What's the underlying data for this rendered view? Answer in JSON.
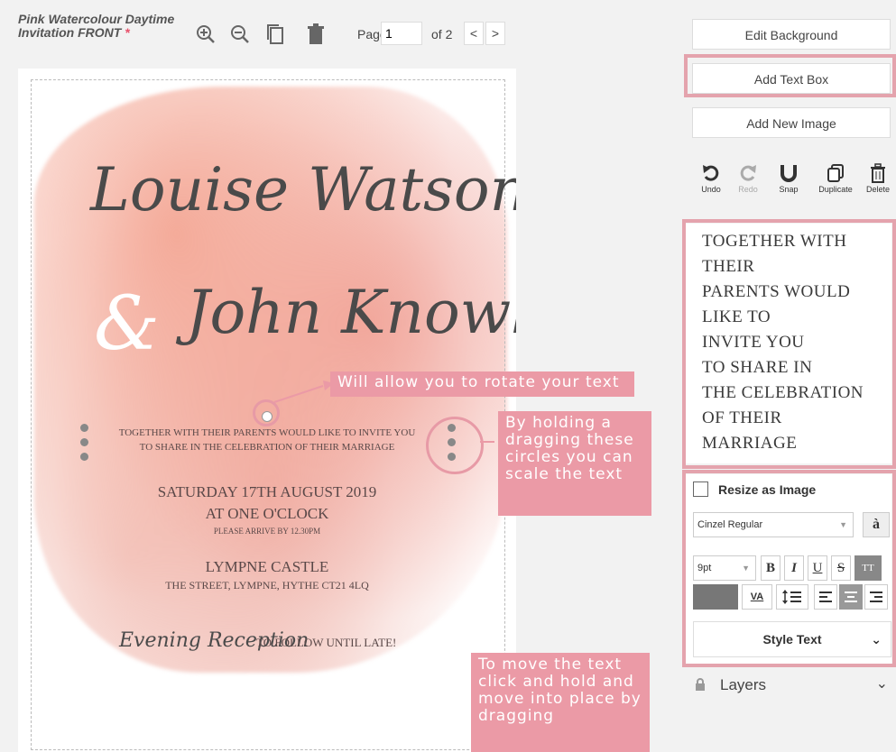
{
  "document": {
    "title": "Pink Watercolour Daytime Invitation FRONT",
    "required_mark": "*"
  },
  "toolbar": {
    "icons": [
      "zoom-in-icon",
      "zoom-out-icon",
      "copy-page-icon",
      "trash-icon"
    ],
    "page_label": "Page",
    "page_value": "1",
    "of_label": "of 2",
    "prev": "<",
    "next": ">"
  },
  "canvas": {
    "names_line1": "Louise Watson",
    "names_line2_amp": "&",
    "names_line2": "John Knowle",
    "together_line1": "TOGETHER WITH THEIR PARENTS WOULD LIKE TO INVITE YOU",
    "together_line2": "TO SHARE IN THE CELEBRATION OF THEIR MARRIAGE",
    "date": "SATURDAY 17TH AUGUST 2019",
    "time": "AT ONE O'CLOCK",
    "arrive": "PLEASE ARRIVE BY 12.30PM",
    "venue": "LYMPNE CASTLE",
    "address": "THE STREET, LYMPNE, HYTHE CT21 4LQ",
    "evening_script": "Evening Reception",
    "evening_rest": "TO FOLLOW UNTIL LATE!"
  },
  "callouts": {
    "rotate": "Will allow you to rotate your text",
    "scale": "By holding a dragging these circles you can scale the text",
    "move": "To move the text click and hold and move into place by dragging"
  },
  "panel": {
    "edit_background": "Edit Background",
    "add_text_box": "Add Text Box",
    "add_new_image": "Add New Image",
    "actions": {
      "undo": "Undo",
      "redo": "Redo",
      "snap": "Snap",
      "duplicate": "Duplicate",
      "delete": "Delete"
    },
    "text_lines": [
      "TOGETHER WITH",
      "THEIR",
      "PARENTS WOULD",
      "LIKE TO",
      "INVITE YOU",
      "TO SHARE IN",
      "THE CELEBRATION",
      "OF THEIR",
      "MARRIAGE"
    ],
    "resize_as_image": "Resize as Image",
    "font": "Cinzel Regular",
    "accent_glyph": "à",
    "size": "9pt",
    "bold": "B",
    "italic": "I",
    "underline": "U",
    "strike": "S",
    "tt": "TT",
    "va": "VA",
    "style_text": "Style Text",
    "layers": "Layers"
  },
  "colors": {
    "highlight": "#e4a3ad",
    "callout": "#eb9aa6",
    "wash": "#f2a898"
  }
}
